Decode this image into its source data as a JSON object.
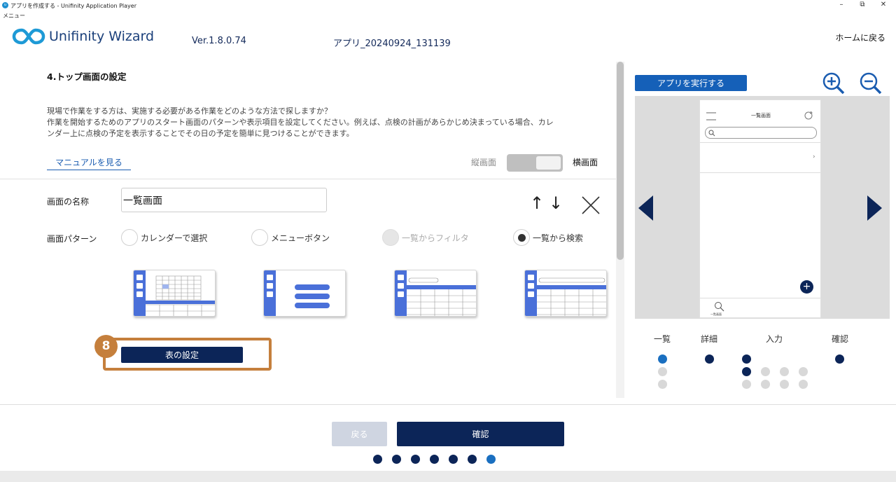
{
  "window": {
    "title": "アプリを作成する - Unifinity Application Player",
    "menu_label": "メニュー",
    "logo_text": "u"
  },
  "header": {
    "brand": "Unifinity Wizard",
    "version": "Ver.1.8.0.74",
    "app_name": "アプリ_20240924_131139",
    "home_label": "ホームに戻る"
  },
  "section": {
    "title": "4.トップ画面の設定",
    "desc_line1": "現場で作業をする方は、実施する必要がある作業をどのような方法で探しますか？",
    "desc_line2": "作業を開始するためのアプリのスタート画面のパターンや表示項目を設定してください。例えば、点検の計画があらかじめ決まっている場合、カレ",
    "desc_line3": "ンダー上に点検の予定を表示することでその日の予定を簡単に見つけることができます。",
    "manual_link": "マニュアルを見る",
    "portrait_label": "縦画面",
    "landscape_label": "横画面"
  },
  "form": {
    "name_label": "画面の名称",
    "name_value": "一覧画面",
    "pattern_label": "画面パターン",
    "patterns": [
      {
        "label": "カレンダーで選択",
        "selected": false,
        "disabled": false
      },
      {
        "label": "メニューボタン",
        "selected": false,
        "disabled": false
      },
      {
        "label": "一覧からフィルタ",
        "selected": false,
        "disabled": true
      },
      {
        "label": "一覧から検索",
        "selected": true,
        "disabled": false
      }
    ],
    "table_settings_label": "表の設定",
    "step_badge": "8"
  },
  "preview": {
    "run_label": "アプリを実行する",
    "phone_title": "一覧画面",
    "phone_tab_label": "一覧画面",
    "columns": [
      "一覧",
      "詳細",
      "入力",
      "確認"
    ]
  },
  "footer": {
    "back_label": "戻る",
    "confirm_label": "確認",
    "progress_total": 7,
    "progress_current": 7
  },
  "colors": {
    "navy": "#0c2558",
    "accent_blue": "#1a6fc0",
    "highlight_orange": "#c57f3c"
  }
}
